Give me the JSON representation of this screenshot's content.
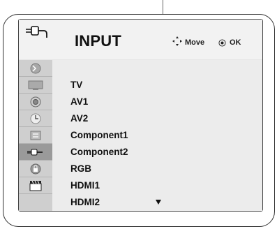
{
  "menu": {
    "title": "INPUT",
    "hints": {
      "move_label": "Move",
      "ok_label": "OK"
    },
    "items": [
      {
        "label": "TV",
        "icon": "tv-antenna-icon"
      },
      {
        "label": "AV1",
        "icon": "picture-icon"
      },
      {
        "label": "AV2",
        "icon": "audio-icon"
      },
      {
        "label": "Component1",
        "icon": "time-icon"
      },
      {
        "label": "Component2",
        "icon": "option-icon"
      },
      {
        "label": "RGB",
        "icon": "input-plug-icon"
      },
      {
        "label": "HDMI1",
        "icon": "lock-icon"
      },
      {
        "label": "HDMI2",
        "icon": "clapperboard-icon"
      }
    ],
    "selected_index": 5
  }
}
